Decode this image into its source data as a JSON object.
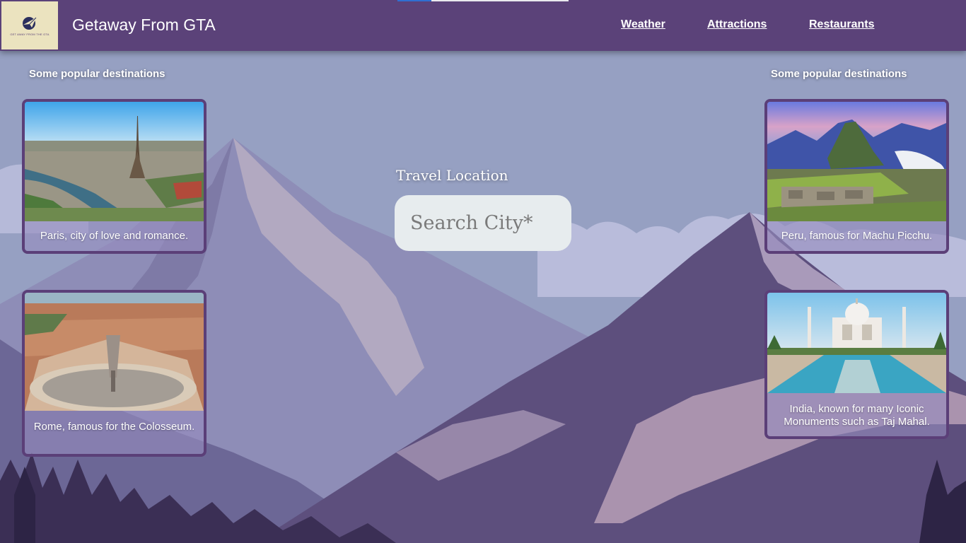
{
  "header": {
    "logo_text": "GET AWAY FROM THE GTA",
    "title": "Getaway From GTA",
    "nav": [
      "Weather",
      "Attractions",
      "Restaurants"
    ]
  },
  "left_column": {
    "title": "Some popular destinations",
    "cards": [
      {
        "caption": "Paris, city of love and romance.",
        "image": "eiffel-tower-photo"
      },
      {
        "caption": "Rome, famous for the Colosseum.",
        "image": "st-peters-square-photo"
      }
    ]
  },
  "right_column": {
    "title": "Some popular destinations",
    "cards": [
      {
        "caption": "Peru, famous for Machu Picchu.",
        "image": "machu-picchu-photo"
      },
      {
        "caption": "India, known for many Iconic Monuments such as Taj Mahal.",
        "image": "taj-mahal-photo"
      }
    ]
  },
  "search": {
    "label": "Travel Location",
    "placeholder": "Search City*"
  },
  "colors": {
    "header": "#5b4279",
    "card_border": "#5b3f78",
    "input_bg": "#e7ecee"
  }
}
